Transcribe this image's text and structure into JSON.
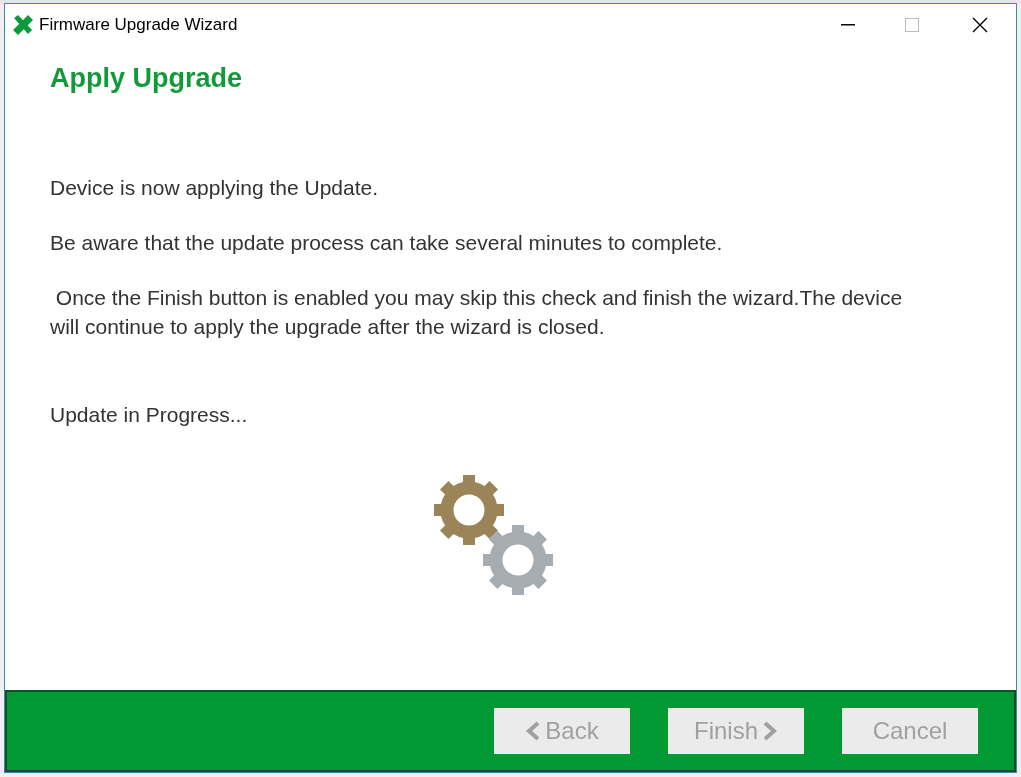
{
  "window": {
    "title": "Firmware Upgrade Wizard"
  },
  "page": {
    "heading": "Apply Upgrade",
    "paragraphs": [
      "Device is now applying the Update.",
      "Be aware that the update process can take several minutes to complete.",
      " Once the Finish button is enabled you may skip this check and finish the wizard.The device will continue to apply the upgrade after the wizard is closed."
    ],
    "status": "Update in Progress..."
  },
  "buttons": [
    {
      "kind": "back",
      "label": "Back",
      "disabled": true
    },
    {
      "kind": "next",
      "label": "Finish",
      "disabled": true
    },
    {
      "kind": "plain",
      "label": "Cancel",
      "disabled": true
    }
  ]
}
